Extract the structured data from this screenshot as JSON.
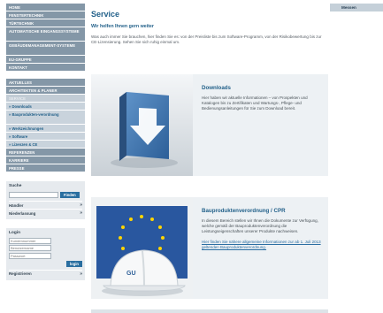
{
  "nav": {
    "items": [
      {
        "label": "HOME",
        "size": "short"
      },
      {
        "label": "FENSTERTECHNIK",
        "size": "short"
      },
      {
        "label": "TÜRTECHNIK",
        "size": "short"
      },
      {
        "label": "AUTOMATISCHE EINGANGSSYSTEME",
        "size": "tall"
      },
      {
        "label": "GEBÄUDEMANAGEMENT-SYSTEME",
        "size": "tall"
      },
      {
        "label": "EU-GRUPPE",
        "size": "short"
      },
      {
        "label": "KONTAKT",
        "size": "short"
      }
    ],
    "items2": [
      {
        "label": "AKTUELLES"
      },
      {
        "label": "ARCHITEKTEN & PLANER"
      },
      {
        "label": "SERVICE"
      }
    ],
    "sub_items": [
      {
        "label": "» Downloads",
        "size": "short"
      },
      {
        "label": "» Bauprodukten-verordnung",
        "size": "tall"
      },
      {
        "label": "» Werkzeichnungen",
        "size": "short"
      },
      {
        "label": "» Software",
        "size": "short"
      },
      {
        "label": "» Lizenzen & CE",
        "size": "short"
      }
    ],
    "items3": [
      {
        "label": "REFERENZEN"
      },
      {
        "label": "KARRIERE"
      },
      {
        "label": "PRESSE"
      }
    ]
  },
  "search": {
    "title": "Suche",
    "placeholder": "",
    "button": "Finden",
    "rows": [
      {
        "label": "Händler",
        "chev": "»"
      },
      {
        "label": "Niederlassung",
        "chev": "»"
      }
    ]
  },
  "login": {
    "title": "Login",
    "fields": [
      "Kundennummer",
      "Benutzername",
      "Passwort"
    ],
    "button": "login",
    "register": {
      "label": "Registrieren",
      "chev": "»"
    }
  },
  "main": {
    "title": "Service",
    "subtitle": "Wir helfen Ihnen gern weiter",
    "intro": "Was auch immer Sie brauchen, hier finden Sie es: von der Preisliste bis zum Software-Programm, von der Risikobewertung bis zur CE-Lizensierung. Sehen Sie sich ruhig einmal um."
  },
  "cards": {
    "downloads": {
      "title": "Downloads",
      "desc": "Hier haben wir aktuelle Informationen – von Prospekten und Katalogen bis zu Zertifikaten und Wartungs-, Pflege- und Bedienungsanleitungen für Sie zum Download bereit."
    },
    "cpr": {
      "title": "Bauproduktenverordnung / CPR",
      "desc": "In diesem Bereich stellen wir Ihnen die Dokumente zur Verfügung, welche gemäß der Bauproduktenverordnung die Leistungseigenschaften unserer Produkte nachweisen.",
      "link": "Hier finden Sie nähere allgemeine Informationen zur ab 1. Juli 2013 geltenden Bauproduktenverordnung."
    }
  },
  "top_tab": {
    "label": "Messen"
  },
  "colors": {
    "nav": "#8497a7",
    "accent": "#23618a",
    "sub_nav": "#c9d3dc",
    "card_bg": "#edf1f4"
  }
}
